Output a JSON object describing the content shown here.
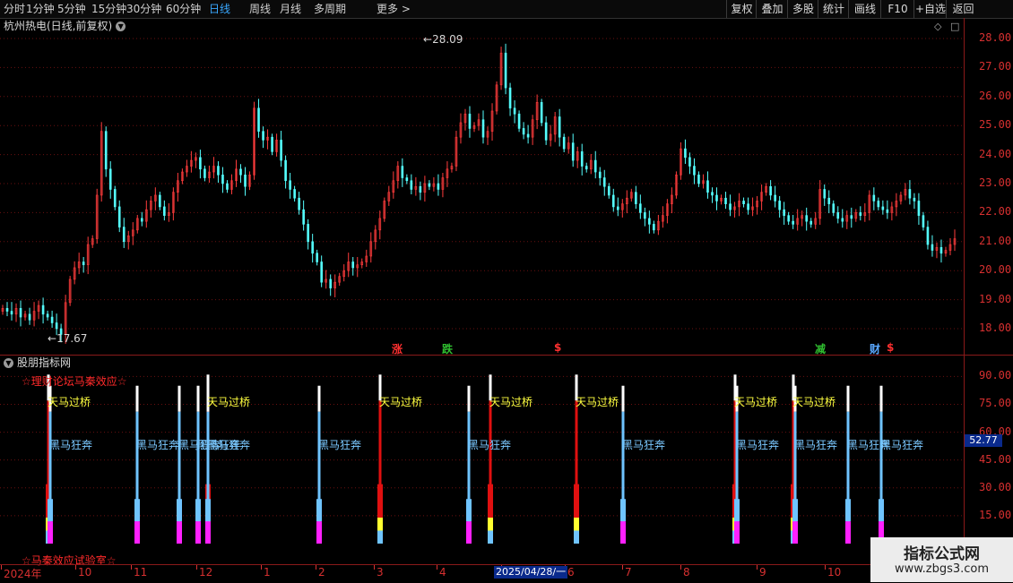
{
  "toolbar": {
    "periods": [
      "分时",
      "1分钟",
      "5分钟",
      "15分钟",
      "30分钟",
      "60分钟",
      "日线",
      "周线",
      "月线",
      "多周期",
      "更多 >"
    ],
    "active_period": "日线",
    "buttons": [
      "复权",
      "叠加",
      "多股",
      "统计",
      "画线",
      "F10",
      "+自选",
      "返回"
    ]
  },
  "title": {
    "text": "杭州热电(日线,前复权)"
  },
  "price_axis": {
    "labels": [
      "28.00",
      "27.00",
      "26.00",
      "25.00",
      "24.00",
      "23.00",
      "22.00",
      "21.00",
      "20.00",
      "19.00",
      "18.00"
    ]
  },
  "annotations": {
    "high": "28.09",
    "low": "17.67"
  },
  "markers": [
    {
      "text": "涨",
      "color": "#ff3030"
    },
    {
      "text": "跌",
      "color": "#30c030"
    },
    {
      "text": "$",
      "color": "#ff3030"
    },
    {
      "text": "减",
      "color": "#30c030"
    },
    {
      "text": "财",
      "color": "#5aa8ff"
    },
    {
      "text": "$",
      "color": "#ff3030"
    }
  ],
  "indicator": {
    "title": "股朋指标网",
    "axis_labels": [
      "90.00",
      "75.00",
      "60.00",
      "45.00",
      "30.00",
      "15.00"
    ],
    "current_value": "52.77",
    "text_top": "☆理财论坛马秦效应☆",
    "text_bottom": "☆马秦效应试验室☆",
    "signal_yellow": "天马过桥",
    "signal_blue": "黑马狂奔"
  },
  "dates": {
    "labels": [
      "2024年",
      "10",
      "11",
      "12",
      "1",
      "2",
      "3",
      "4",
      "5",
      "6",
      "7",
      "8",
      "9",
      "10"
    ],
    "current": "2025/04/28/一"
  },
  "watermark": {
    "line1": "指标公式网",
    "line2": "www.zbgs3.com"
  },
  "colors": {
    "up": "#ff3c3c",
    "down": "#54ffff",
    "axis": "#d73030",
    "panel_sep": "#8a1a1a"
  },
  "chart_data": {
    "type": "candlestick",
    "ylim": [
      17.5,
      28.2
    ],
    "closes": [
      18.7,
      18.6,
      18.5,
      18.7,
      18.4,
      18.5,
      18.3,
      18.6,
      18.8,
      18.5,
      18.4,
      18.2,
      18.0,
      17.8,
      18.9,
      19.7,
      20.1,
      20.3,
      20.2,
      20.9,
      21.1,
      22.6,
      24.8,
      23.5,
      22.8,
      22.2,
      21.5,
      21.0,
      21.2,
      21.4,
      21.8,
      21.7,
      22.1,
      22.4,
      22.6,
      22.2,
      21.9,
      22.0,
      22.7,
      23.1,
      23.4,
      23.6,
      23.8,
      23.9,
      23.5,
      23.2,
      23.4,
      23.6,
      23.3,
      23.0,
      22.8,
      23.1,
      23.5,
      23.3,
      22.9,
      23.3,
      25.6,
      24.8,
      24.5,
      24.6,
      24.1,
      24.5,
      23.8,
      23.1,
      22.8,
      22.5,
      22.1,
      21.6,
      21.0,
      20.6,
      20.3,
      19.6,
      19.7,
      19.4,
      19.6,
      19.8,
      20.0,
      20.3,
      20.1,
      20.2,
      20.3,
      20.5,
      21.0,
      21.4,
      21.8,
      22.4,
      22.7,
      23.1,
      23.6,
      23.2,
      23.1,
      22.8,
      22.9,
      22.7,
      23.0,
      22.9,
      23.0,
      22.8,
      23.2,
      23.5,
      23.6,
      24.6,
      25.1,
      25.4,
      24.9,
      25.0,
      25.2,
      24.6,
      24.8,
      25.5,
      26.4,
      27.5,
      26.3,
      25.6,
      25.4,
      24.9,
      24.7,
      24.6,
      25.2,
      25.8,
      25.1,
      24.5,
      24.7,
      25.3,
      24.6,
      24.2,
      24.4,
      23.8,
      24.1,
      23.6,
      23.5,
      23.8,
      23.4,
      23.2,
      22.9,
      22.6,
      22.2,
      22.1,
      22.3,
      22.5,
      22.7,
      22.3,
      22.0,
      21.8,
      21.6,
      21.4,
      21.7,
      21.9,
      22.3,
      22.6,
      23.3,
      24.2,
      23.9,
      23.6,
      23.3,
      23.0,
      23.1,
      22.7,
      22.6,
      22.4,
      22.5,
      22.3,
      22.1,
      22.2,
      22.4,
      22.3,
      22.1,
      22.2,
      22.4,
      22.7,
      22.9,
      22.6,
      22.4,
      22.1,
      21.9,
      21.7,
      21.6,
      21.8,
      21.9,
      21.7,
      21.6,
      21.8,
      22.8,
      22.5,
      22.3,
      22.0,
      21.8,
      21.7,
      21.9,
      21.8,
      22.0,
      21.9,
      22.0,
      22.6,
      22.4,
      22.2,
      22.1,
      22.0,
      22.2,
      22.4,
      22.6,
      22.8,
      22.5,
      22.4,
      21.9,
      21.5,
      20.9,
      20.7,
      20.8,
      20.6,
      20.7,
      20.9,
      21.1
    ]
  }
}
